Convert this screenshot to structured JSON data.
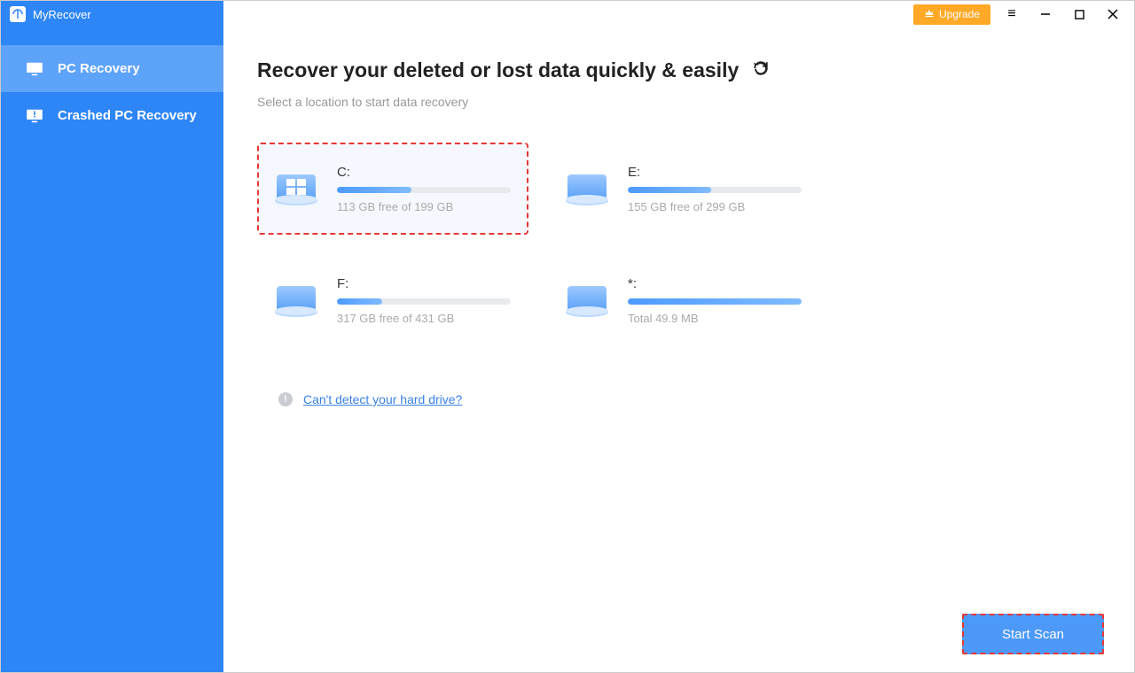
{
  "app": {
    "name": "MyRecover"
  },
  "titlebar": {
    "upgrade_label": "Upgrade"
  },
  "sidebar": {
    "items": [
      {
        "label": "PC Recovery",
        "active": true
      },
      {
        "label": "Crashed PC Recovery",
        "active": false
      }
    ]
  },
  "main": {
    "heading": "Recover your deleted or lost data quickly & easily",
    "subtitle": "Select a location to start data recovery",
    "detect_link": "Can't detect your hard drive?",
    "start_button": "Start Scan"
  },
  "drives": [
    {
      "label": "C:",
      "meta": "113 GB free of 199 GB",
      "fill_pct": 43,
      "icon": "windows",
      "selected": true
    },
    {
      "label": "E:",
      "meta": "155 GB free of 299 GB",
      "fill_pct": 48,
      "icon": "disk",
      "selected": false
    },
    {
      "label": "F:",
      "meta": "317 GB free of 431 GB",
      "fill_pct": 26,
      "icon": "disk",
      "selected": false
    },
    {
      "label": "*:",
      "meta": "Total 49.9 MB",
      "fill_pct": 100,
      "icon": "disk",
      "selected": false
    }
  ]
}
